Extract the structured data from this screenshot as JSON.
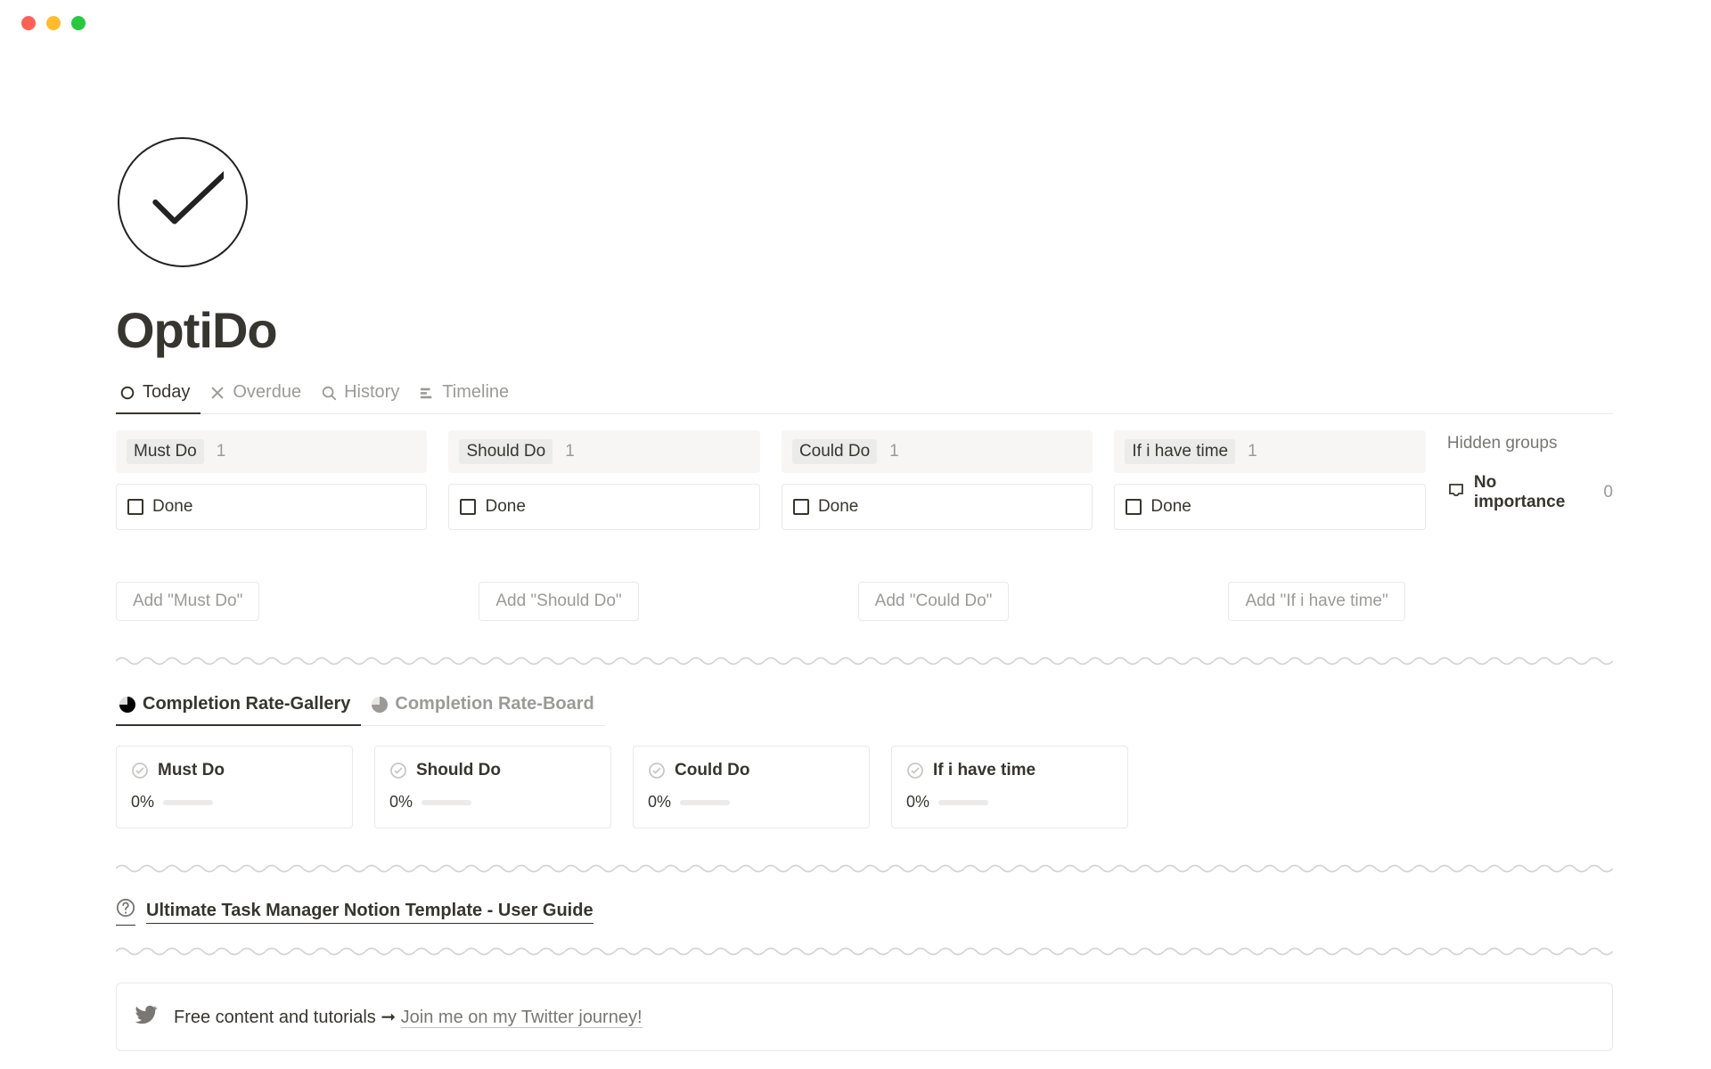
{
  "page_title": "OptiDo",
  "views": [
    {
      "label": "Today",
      "icon": "circle"
    },
    {
      "label": "Overdue",
      "icon": "x"
    },
    {
      "label": "History",
      "icon": "search"
    },
    {
      "label": "Timeline",
      "icon": "timeline"
    }
  ],
  "columns": [
    {
      "tag": "Must Do",
      "count": "1",
      "card": "Done",
      "add": "Add \"Must Do\""
    },
    {
      "tag": "Should Do",
      "count": "1",
      "card": "Done",
      "add": "Add \"Should Do\""
    },
    {
      "tag": "Could Do",
      "count": "1",
      "card": "Done",
      "add": "Add \"Could Do\""
    },
    {
      "tag": "If i have time",
      "count": "1",
      "card": "Done",
      "add": "Add \"If i have time\""
    }
  ],
  "hidden": {
    "title": "Hidden groups",
    "item": "No importance",
    "count": "0"
  },
  "subviews": [
    {
      "label": "Completion Rate-Gallery"
    },
    {
      "label": "Completion Rate-Board"
    }
  ],
  "gallery": [
    {
      "title": "Must Do",
      "pct": "0%"
    },
    {
      "title": "Should Do",
      "pct": "0%"
    },
    {
      "title": "Could Do",
      "pct": "0%"
    },
    {
      "title": "If i have time",
      "pct": "0%"
    }
  ],
  "guide": "Ultimate Task Manager Notion Template - User Guide",
  "twitter": {
    "text": "Free content and tutorials ➞ ",
    "link": "Join me on my Twitter journey!"
  }
}
